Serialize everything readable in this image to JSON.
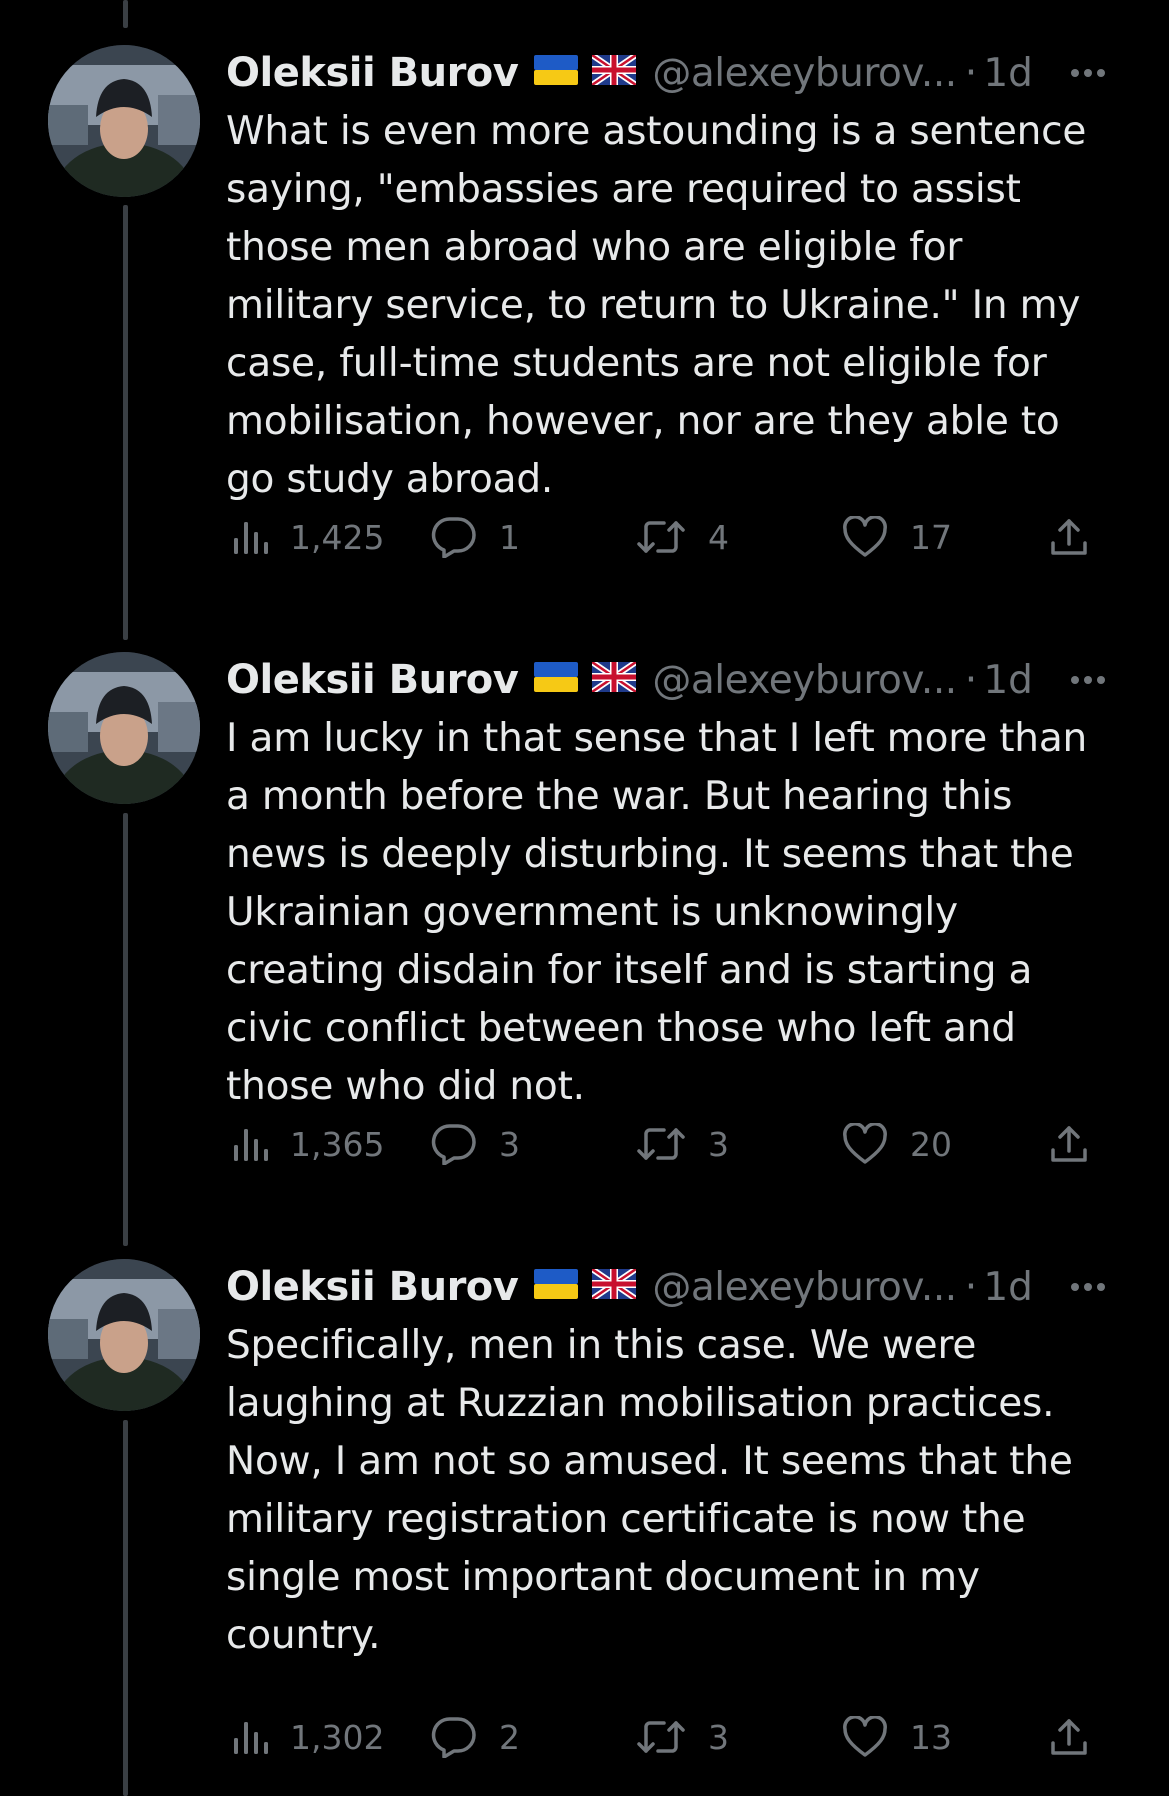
{
  "thread": {
    "tweets": [
      {
        "author": "Oleksii Burov",
        "flags": [
          "ukraine-flag",
          "uk-flag"
        ],
        "handle": "@alexeyburov...",
        "separator": "·",
        "time": "1d",
        "text": "What is even more astounding is a sentence\nsaying, \"embassies are required to assist\nthose men abroad who are eligible for\nmilitary service, to return to Ukraine.\" In my\ncase, full-time students are not eligible for\nmobilisation, however, nor are they able to\ngo study abroad.",
        "views": "1,425",
        "replies": "1",
        "retweets": "4",
        "likes": "17"
      },
      {
        "author": "Oleksii Burov",
        "flags": [
          "ukraine-flag",
          "uk-flag"
        ],
        "handle": "@alexeyburov...",
        "separator": "·",
        "time": "1d",
        "text": "I am lucky in that sense that I left more than\na month before the war. But hearing this\nnews is deeply disturbing. It seems that the\nUkrainian government is unknowingly\ncreating disdain for itself and is starting a\ncivic conflict between those who left and\nthose who did not.",
        "views": "1,365",
        "replies": "3",
        "retweets": "3",
        "likes": "20"
      },
      {
        "author": "Oleksii Burov",
        "flags": [
          "ukraine-flag",
          "uk-flag"
        ],
        "handle": "@alexeyburov...",
        "separator": "·",
        "time": "1d",
        "text": "Specifically, men in this case. We were\nlaughing at Ruzzian mobilisation practices.\nNow, I am not so amused. It seems that the\nmilitary registration certificate is now the\nsingle most important document in my\ncountry.",
        "views": "1,302",
        "replies": "2",
        "retweets": "3",
        "likes": "13"
      }
    ]
  },
  "colors": {
    "background": "#000000",
    "text_primary": "#e7e9ea",
    "text_secondary": "#71767b",
    "thread_line": "#3a3f44"
  },
  "icons": {
    "views": "bar-chart-icon",
    "reply": "speech-bubble-icon",
    "retweet": "retweet-arrows-icon",
    "like": "heart-icon",
    "share": "share-upload-icon",
    "more": "more-dots-icon"
  }
}
